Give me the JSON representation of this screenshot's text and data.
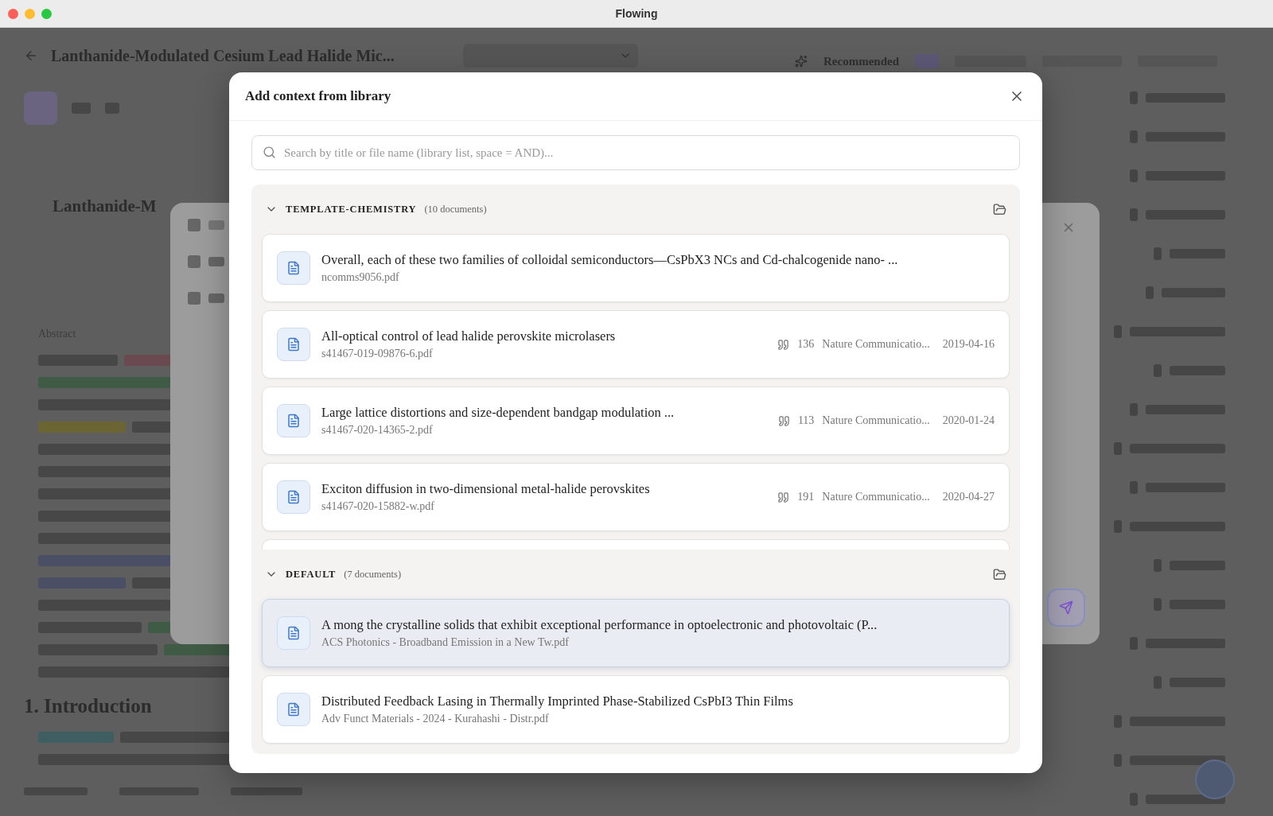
{
  "window": {
    "title": "Flowing"
  },
  "background": {
    "document_title": "Lanthanide-Modulated Cesium Lead Halide Mic...",
    "page_heading": "Lanthanide-M",
    "abstract_label": "Abstract",
    "section_heading": "1. Introduction",
    "tab_label": "Recommended"
  },
  "dialog": {
    "title": "Add context from library",
    "search": {
      "placeholder": "Search by title or file name (library list, space = AND)..."
    },
    "groups": [
      {
        "name": "TEMPLATE-CHEMISTRY",
        "count": "(10 documents)",
        "expanded": true,
        "more_below": true,
        "documents": [
          {
            "title": "Overall, each of these two families of colloidal semiconductors—CsPbX3 NCs and Cd-chalcogenide nano- ...",
            "file": "ncomms9056.pdf",
            "selected": false
          },
          {
            "title": "All-optical control of lead halide perovskite microlasers",
            "file": "s41467-019-09876-6.pdf",
            "citations": "136",
            "journal": "Nature Communicatio...",
            "date": "2019-04-16",
            "selected": false
          },
          {
            "title": "Large lattice distortions and size-dependent bandgap modulation ...",
            "file": "s41467-020-14365-2.pdf",
            "citations": "113",
            "journal": "Nature Communicatio...",
            "date": "2020-01-24",
            "selected": false
          },
          {
            "title": "Exciton diffusion in two-dimensional metal-halide perovskites",
            "file": "s41467-020-15882-w.pdf",
            "citations": "191",
            "journal": "Nature Communicatio...",
            "date": "2020-04-27",
            "selected": false
          }
        ]
      },
      {
        "name": "DEFAULT",
        "count": "(7 documents)",
        "expanded": true,
        "more_below": false,
        "documents": [
          {
            "title": "A mong the crystalline solids that exhibit exceptional performance in optoelectronic and photovoltaic (P...",
            "file": "ACS Photonics - Broadband Emission in a New Tw.pdf",
            "selected": true
          },
          {
            "title": "Distributed Feedback Lasing in Thermally Imprinted Phase-Stabilized CsPbI3 Thin Films",
            "file": "Adv Funct Materials - 2024 - Kurahashi - Distr.pdf",
            "selected": false
          }
        ]
      }
    ]
  }
}
